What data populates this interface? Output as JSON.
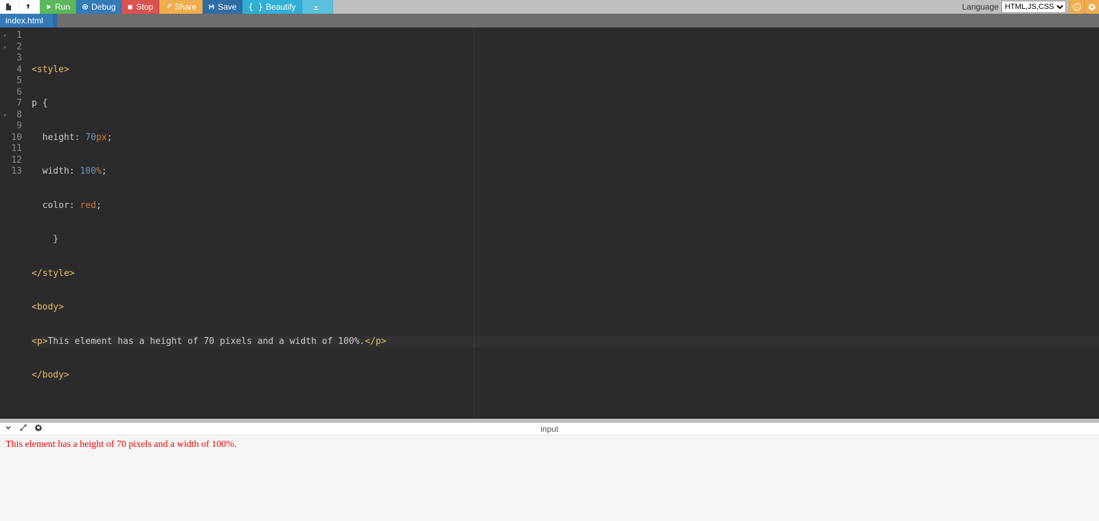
{
  "toolbar": {
    "run": "Run",
    "debug": "Debug",
    "stop": "Stop",
    "share": "Share",
    "save": "Save",
    "beautify": "Beautify",
    "language_label": "Language",
    "language_value": "HTML,JS,CSS"
  },
  "tab": {
    "filename": "index.html"
  },
  "editor": {
    "line_count": 13,
    "active_line": 9,
    "fold_lines": [
      1,
      2,
      8
    ],
    "lines": {
      "l1_open": "<style>",
      "l2_sel": "p",
      "l2_brace": " {",
      "l3_prop": "  height",
      "l3_colon": ": ",
      "l3_num": "70",
      "l3_unit": "px",
      "l3_semi": ";",
      "l4_prop": "  width",
      "l4_colon": ": ",
      "l4_num": "100",
      "l4_unit": "%",
      "l4_semi": ";",
      "l5_prop": "  color",
      "l5_colon": ": ",
      "l5_val": "red",
      "l5_semi": ";",
      "l6": "    }",
      "l7": "</style>",
      "l8": "<body>",
      "l9_open": "<p>",
      "l9_text": "This element has a height of 70 pixels and a width of 100%.",
      "l9_close": "</p>",
      "l10": "</body>"
    }
  },
  "output": {
    "center_label": "input",
    "text": "This element has a height of 70 pixels and a width of 100%."
  }
}
